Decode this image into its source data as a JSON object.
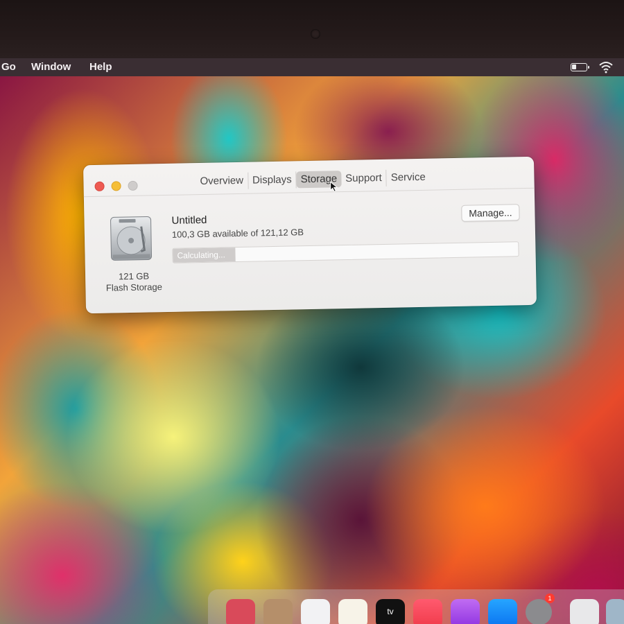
{
  "menubar": {
    "items": [
      "Go",
      "Window",
      "Help"
    ]
  },
  "window": {
    "tabs": [
      "Overview",
      "Displays",
      "Storage",
      "Support",
      "Service"
    ],
    "active_tab": "Storage",
    "disk": {
      "name": "Untitled",
      "availability": "100,3 GB available of 121,12 GB",
      "size_line1": "121 GB",
      "size_line2": "Flash Storage",
      "manage_label": "Manage...",
      "progress_label": "Calculating...",
      "progress_fraction": 0.18
    }
  },
  "dock": {
    "apps": [
      "app",
      "app",
      "app",
      "app",
      "tv",
      "music",
      "podcasts",
      "app-store",
      "system-preferences",
      "app",
      "app"
    ],
    "tv_label": "tv",
    "badge_count": "1"
  },
  "colors": {
    "close": "#ee5a52",
    "minimize": "#f5be37",
    "zoom_disabled": "#cfcccb",
    "active_tab": "#cdcac8"
  }
}
